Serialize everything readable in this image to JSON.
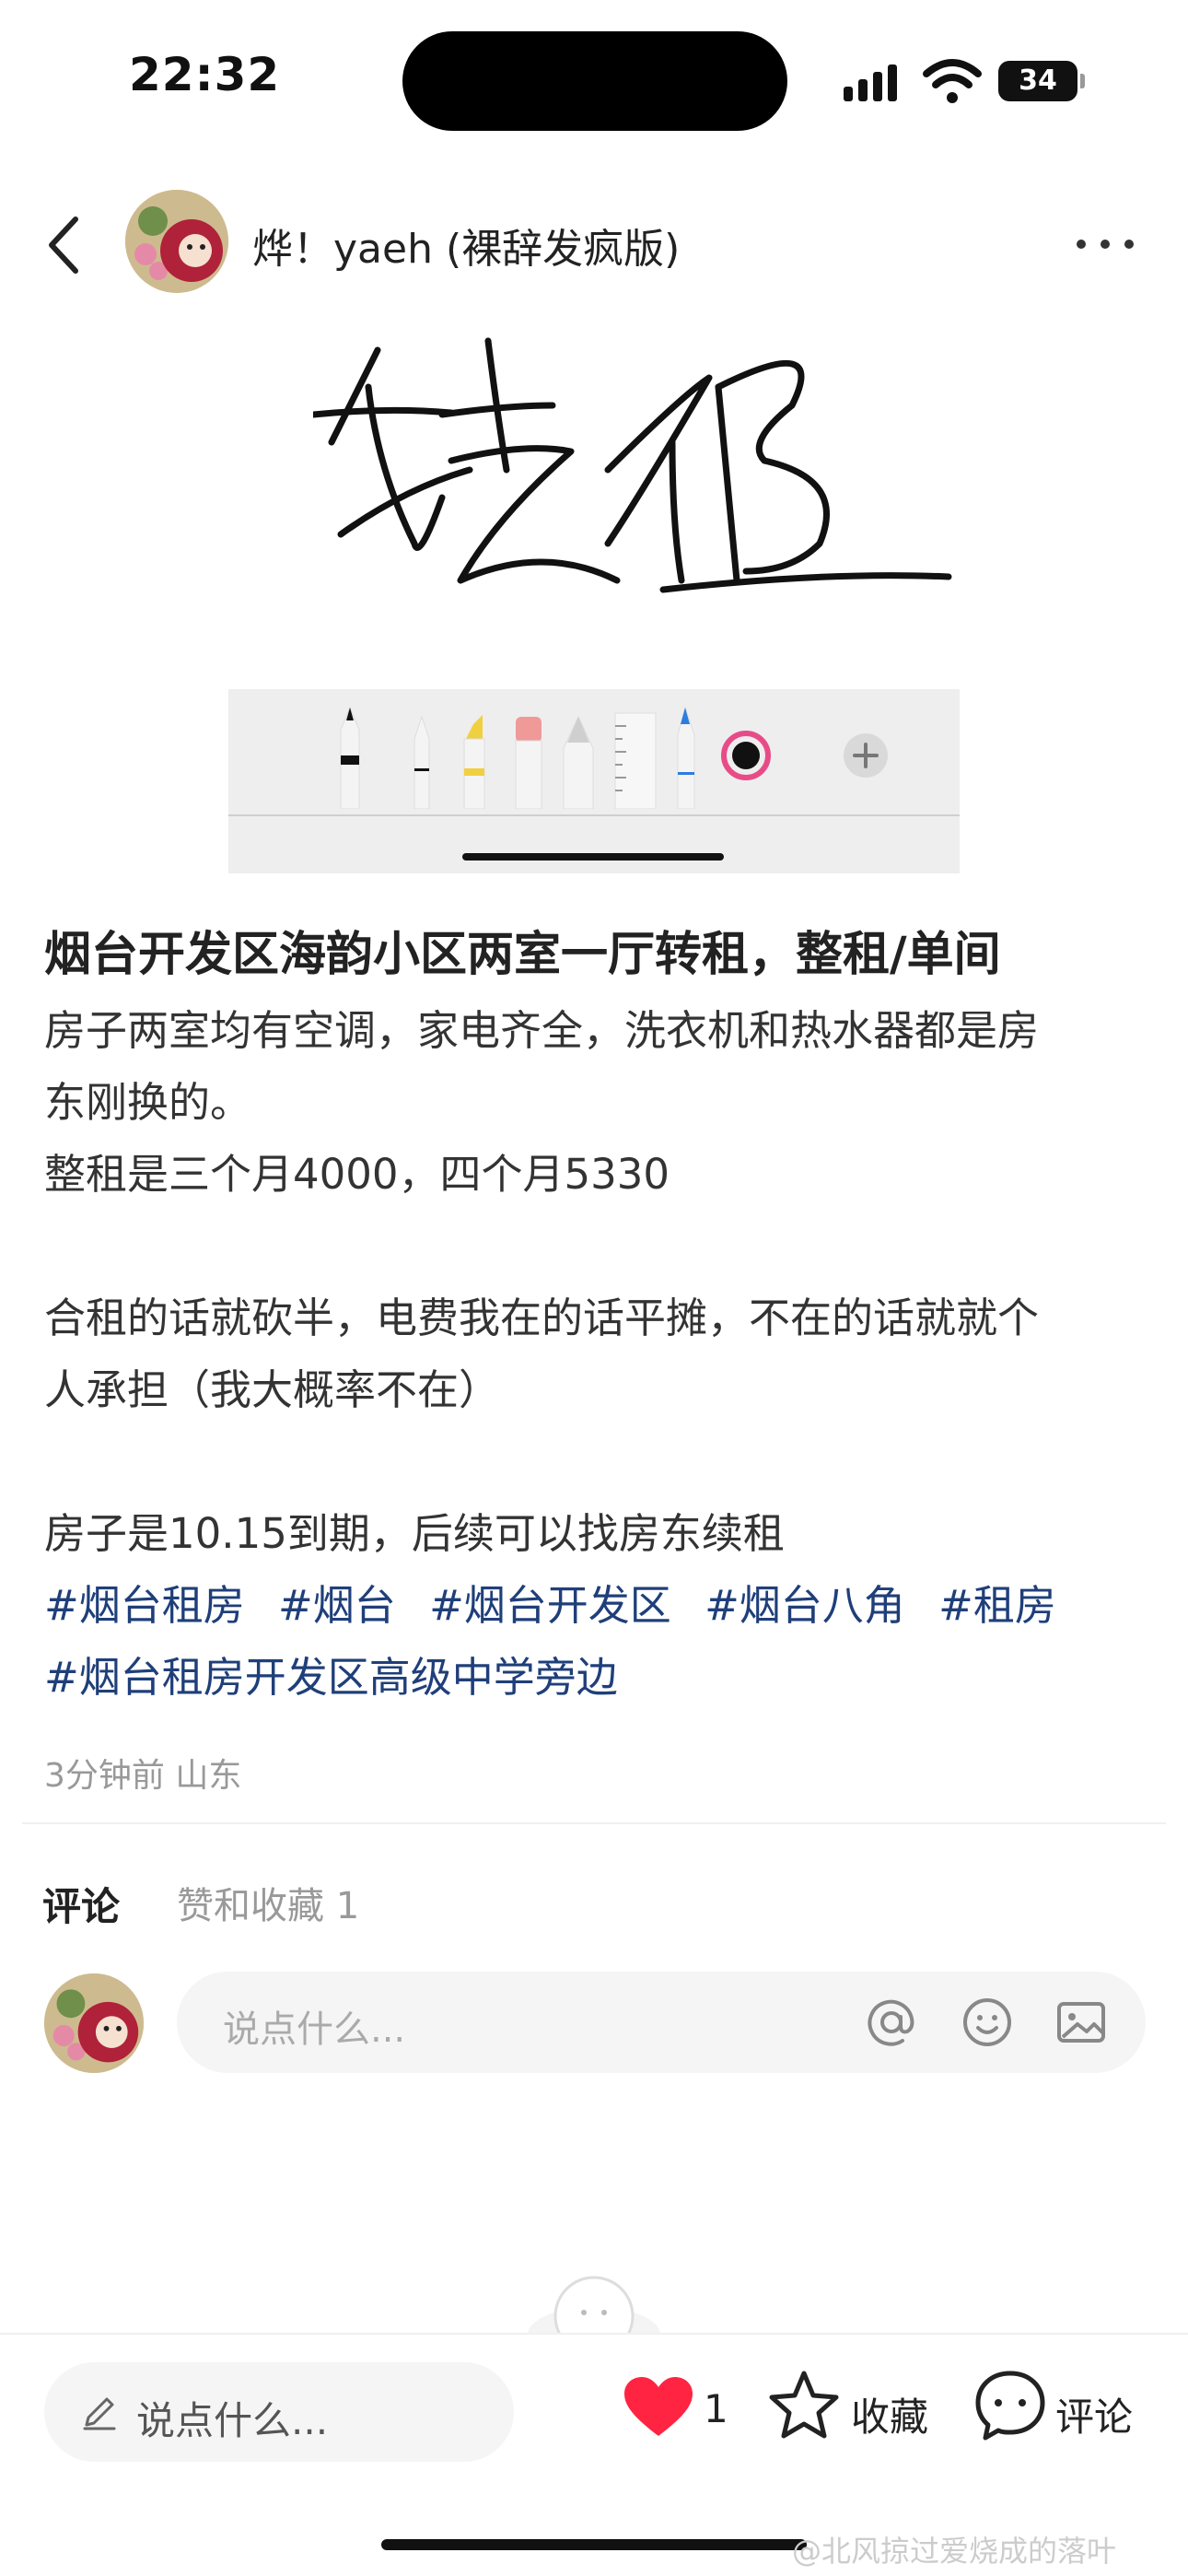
{
  "status_bar": {
    "time": "22:32",
    "battery": "34",
    "icons": [
      "signal-icon",
      "wifi-icon",
      "battery-icon"
    ]
  },
  "header": {
    "author_name": "烨！yaeh (裸辞发疯版)",
    "icons": [
      "back-icon",
      "more-icon"
    ]
  },
  "post": {
    "title": "烟台开发区海韵小区两室一厅转租，整租/单间",
    "body_lines": [
      "房子两室均有空调，家电齐全，洗衣机和热水器都是房",
      "东刚换的。",
      "整租是三个月4000，四个月5330",
      "",
      "合租的话就砍半，电费我在的话平摊，不在的话就就个",
      "人承担（我大概率不在）",
      "",
      "房子是10.15到期，后续可以找房东续租"
    ],
    "tags": [
      "#烟台租房",
      "#烟台",
      "#烟台开发区",
      "#烟台八角",
      "#租房"
    ],
    "tag_line2": "#烟台租房开发区高级中学旁边",
    "meta": "3分钟前 山东"
  },
  "comments": {
    "tab_comments": "评论",
    "tab_likes": "赞和收藏 1",
    "input_placeholder": "说点什么...",
    "input_icons": [
      "at-icon",
      "emoji-icon",
      "image-icon"
    ]
  },
  "bottom_bar": {
    "input_placeholder": "说点什么...",
    "like_count": "1",
    "favorite_label": "收藏",
    "comment_label": "评论",
    "heart_color": "#ff2442"
  },
  "watermark": "@北风掠过爱烧成的落叶"
}
